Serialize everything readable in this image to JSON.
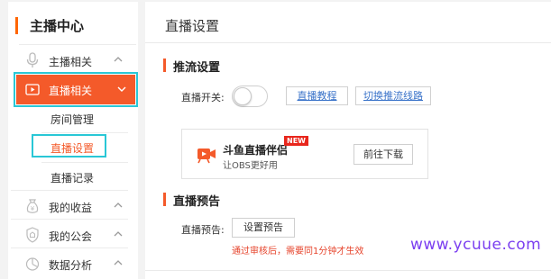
{
  "sidebar": {
    "title": "主播中心",
    "items": [
      {
        "label": "主播相关",
        "icon": "microphone-icon",
        "state": "collapsed"
      },
      {
        "label": "直播相关",
        "icon": "live-video-icon",
        "state": "expanded"
      },
      {
        "label": "我的收益",
        "icon": "money-bag-icon",
        "state": "collapsed"
      },
      {
        "label": "我的公会",
        "icon": "shield-icon",
        "state": "collapsed"
      },
      {
        "label": "数据分析",
        "icon": "pie-chart-icon",
        "state": "collapsed"
      }
    ],
    "submenu": [
      "房间管理",
      "直播设置",
      "直播记录"
    ],
    "accent_color": "#f45a2a",
    "highlight_color": "#29c7d6"
  },
  "main": {
    "title": "直播设置",
    "push": {
      "heading": "推流设置",
      "switch_label": "直播开关:",
      "switch_on": false,
      "tutorial_link": "直播教程",
      "switch_route_link": "切换推流线路"
    },
    "promo": {
      "app_name": "斗鱼直播伴侣",
      "badge": "NEW",
      "desc": "让OBS更好用",
      "download_button": "前往下载"
    },
    "preview": {
      "heading": "直播预告",
      "label": "直播预告:",
      "button": "设置预告"
    },
    "notice": "通过审核后，需要同1分钟才生效",
    "watermark": "www.ycuue.com"
  }
}
